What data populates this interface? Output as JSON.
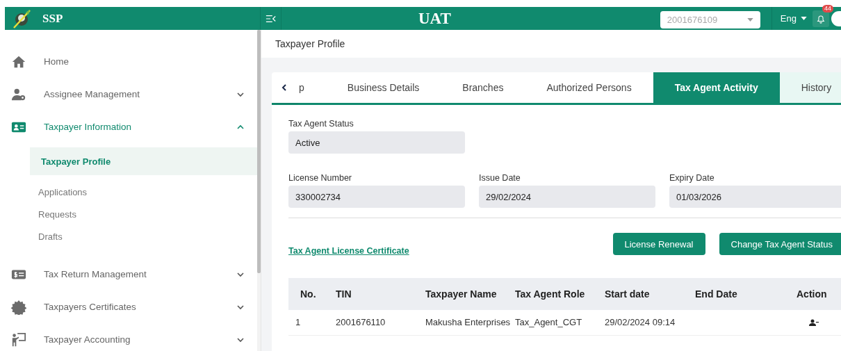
{
  "header": {
    "brand": "SSP",
    "env": "UAT",
    "account": {
      "placeholder": "2001676109"
    },
    "language": "Eng",
    "notifications": "44"
  },
  "sidebar": {
    "items": [
      {
        "label": "Home"
      },
      {
        "label": "Assignee Management",
        "expanded": false
      },
      {
        "label": "Taxpayer Information",
        "expanded": true,
        "children": [
          {
            "label": "Taxpayer Profile",
            "selected": true
          },
          {
            "label": "Applications",
            "selected": false
          },
          {
            "label": "Requests",
            "selected": false
          },
          {
            "label": "Drafts",
            "selected": false
          }
        ]
      },
      {
        "label": "Tax Return Management",
        "expanded": false
      },
      {
        "label": "Taxpayers Certificates",
        "expanded": false
      },
      {
        "label": "Taxpayer Accounting",
        "expanded": false
      }
    ]
  },
  "breadcrumb": "Taxpayer Profile",
  "tabs": [
    {
      "label": "p",
      "selected": false,
      "highlighted": false
    },
    {
      "label": "Business Details",
      "selected": false,
      "highlighted": false
    },
    {
      "label": "Branches",
      "selected": false,
      "highlighted": false
    },
    {
      "label": "Authorized Persons",
      "selected": false,
      "highlighted": false
    },
    {
      "label": "Tax Agent Activity",
      "selected": true,
      "highlighted": false
    },
    {
      "label": "History",
      "selected": false,
      "highlighted": true
    }
  ],
  "status_field": {
    "label": "Tax Agent Status",
    "value": "Active"
  },
  "fields": [
    {
      "label": "License Number",
      "value": "330002734"
    },
    {
      "label": "Issue Date",
      "value": "29/02/2024"
    },
    {
      "label": "Expiry Date",
      "value": "01/03/2026"
    }
  ],
  "certificate_link": "Tax Agent License Certificate",
  "buttons": [
    "License Renewal",
    "Change Tax Agent Status"
  ],
  "table": {
    "columns": [
      "No.",
      "TIN",
      "Taxpayer Name",
      "Tax Agent Role",
      "Start date",
      "End Date",
      "Action"
    ],
    "rows": [
      {
        "cells": [
          "1",
          "2001676110",
          "Makusha Enterprises",
          "Tax_Agent_CGT",
          "29/02/2024 09:14",
          ""
        ]
      }
    ]
  }
}
